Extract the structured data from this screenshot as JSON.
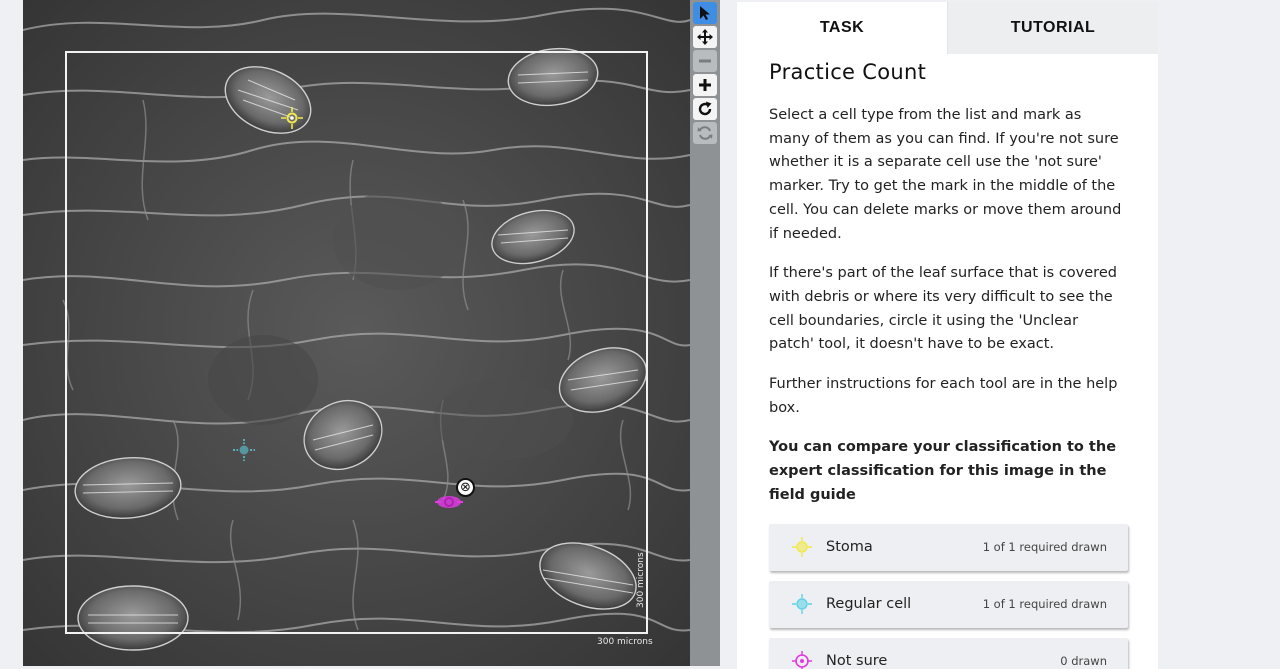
{
  "viewer": {
    "scale_x_label": "300 microns",
    "scale_y_label": "300 microns",
    "delete_symbol": "⊗",
    "colors": {
      "stoma": "#f2e84a",
      "regular": "#5fd3e6",
      "not_sure": "#e23be6",
      "frame": "#f2f2f2"
    }
  },
  "toolbar": {
    "tools": [
      {
        "name": "pointer-icon",
        "state": "active"
      },
      {
        "name": "move-icon",
        "state": "light"
      },
      {
        "name": "zoom-out-icon",
        "state": "disabled"
      },
      {
        "name": "zoom-in-icon",
        "state": "light"
      },
      {
        "name": "rotate-icon",
        "state": "light"
      },
      {
        "name": "reset-icon",
        "state": "disabled"
      }
    ]
  },
  "tabs": {
    "task": "TASK",
    "tutorial": "TUTORIAL"
  },
  "task": {
    "heading": "Practice Count",
    "p1": "Select a cell type from the list and mark as many of them as you can find. If you're not sure whether it is a separate cell use the 'not sure' marker. Try to get the mark in the middle of the cell. You can delete marks or move them around if needed.",
    "p2": "If there's part of the leaf surface that is covered with debris or where its very difficult to see the cell boundaries, circle it using the 'Unclear patch' tool, it doesn't have to be exact.",
    "p3": "Further instructions for each tool are in the help box.",
    "p4": "You can compare your classification to the expert classification for this image in the field guide",
    "choices": [
      {
        "label": "Stoma",
        "count": "1 of 1 required drawn",
        "icon": "crosshair-icon",
        "color": "#f2e84a"
      },
      {
        "label": "Regular cell",
        "count": "1 of 1 required drawn",
        "icon": "crosshair-icon",
        "color": "#5fd3e6"
      },
      {
        "label": "Not sure",
        "count": "0 drawn",
        "icon": "crosshair-icon",
        "color": "#e23be6"
      }
    ]
  }
}
